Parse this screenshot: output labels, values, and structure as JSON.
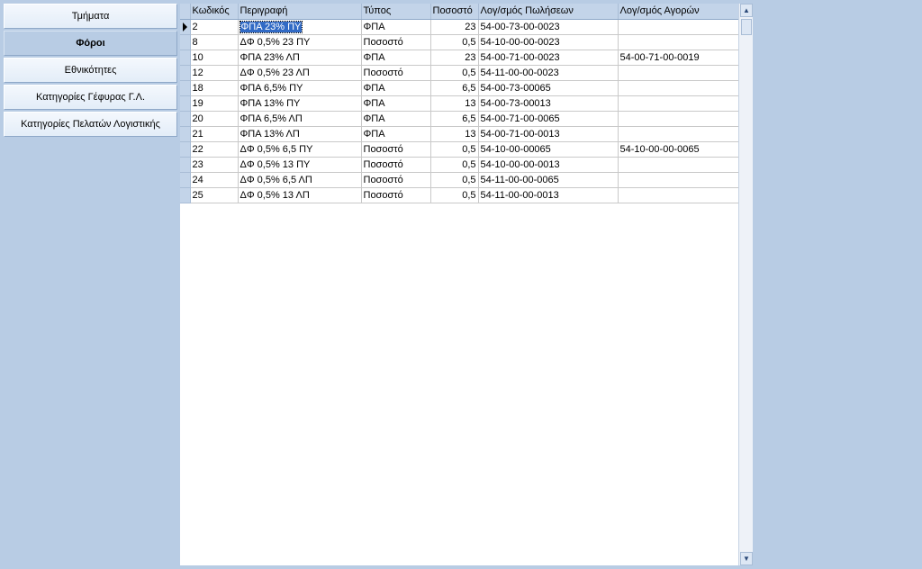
{
  "sidebar": {
    "items": [
      {
        "label": "Τμήματα",
        "active": false
      },
      {
        "label": "Φόροι",
        "active": true
      },
      {
        "label": "Εθνικότητες",
        "active": false
      },
      {
        "label": "Κατηγορίες Γέφυρας Γ.Λ.",
        "active": false
      },
      {
        "label": "Κατηγορίες Πελατών Λογιστικής",
        "active": false
      }
    ]
  },
  "grid": {
    "columns": [
      "Κωδικός",
      "Περιγραφή",
      "Τύπος",
      "Ποσοστό",
      "Λογ/σμός Πωλήσεων",
      "Λογ/σμός Αγορών"
    ],
    "rows": [
      [
        "2",
        "ΦΠΑ 23% ΠΥ",
        "ΦΠΑ",
        "23",
        "54-00-73-00-0023",
        ""
      ],
      [
        "8",
        "ΔΦ 0,5% 23 ΠΥ",
        "Ποσοστό",
        "0,5",
        "54-10-00-00-0023",
        ""
      ],
      [
        "10",
        "ΦΠΑ 23% ΛΠ",
        "ΦΠΑ",
        "23",
        "54-00-71-00-0023",
        "54-00-71-00-0019"
      ],
      [
        "12",
        "ΔΦ 0,5% 23 ΛΠ",
        "Ποσοστό",
        "0,5",
        "54-11-00-00-0023",
        ""
      ],
      [
        "18",
        "ΦΠΑ 6,5% ΠΥ",
        "ΦΠΑ",
        "6,5",
        "54-00-73-00065",
        ""
      ],
      [
        "19",
        "ΦΠΑ 13% ΠΥ",
        "ΦΠΑ",
        "13",
        "54-00-73-00013",
        ""
      ],
      [
        "20",
        "ΦΠΑ 6,5% ΛΠ",
        "ΦΠΑ",
        "6,5",
        "54-00-71-00-0065",
        ""
      ],
      [
        "21",
        "ΦΠΑ 13% ΛΠ",
        "ΦΠΑ",
        "13",
        "54-00-71-00-0013",
        ""
      ],
      [
        "22",
        "ΔΦ 0,5%  6,5 ΠΥ",
        "Ποσοστό",
        "0,5",
        "54-10-00-00065",
        "54-10-00-00-0065"
      ],
      [
        "23",
        "ΔΦ 0,5%  13 ΠΥ",
        "Ποσοστό",
        "0,5",
        "54-10-00-00-0013",
        ""
      ],
      [
        "24",
        "ΔΦ 0,5%  6,5 ΛΠ",
        "Ποσοστό",
        "0,5",
        "54-11-00-00-0065",
        ""
      ],
      [
        "25",
        "ΔΦ 0,5%  13 ΛΠ",
        "Ποσοστό",
        "0,5",
        "54-11-00-00-0013",
        ""
      ]
    ],
    "current_row": 0,
    "editing_cell": {
      "row": 0,
      "col": 1
    }
  },
  "scrollbar": {
    "up_icon": "arrow-up-icon",
    "down_icon": "arrow-down-icon"
  },
  "colors": {
    "background": "#b8cce4",
    "header": "#c3d4e9",
    "selection": "#316ac5"
  }
}
